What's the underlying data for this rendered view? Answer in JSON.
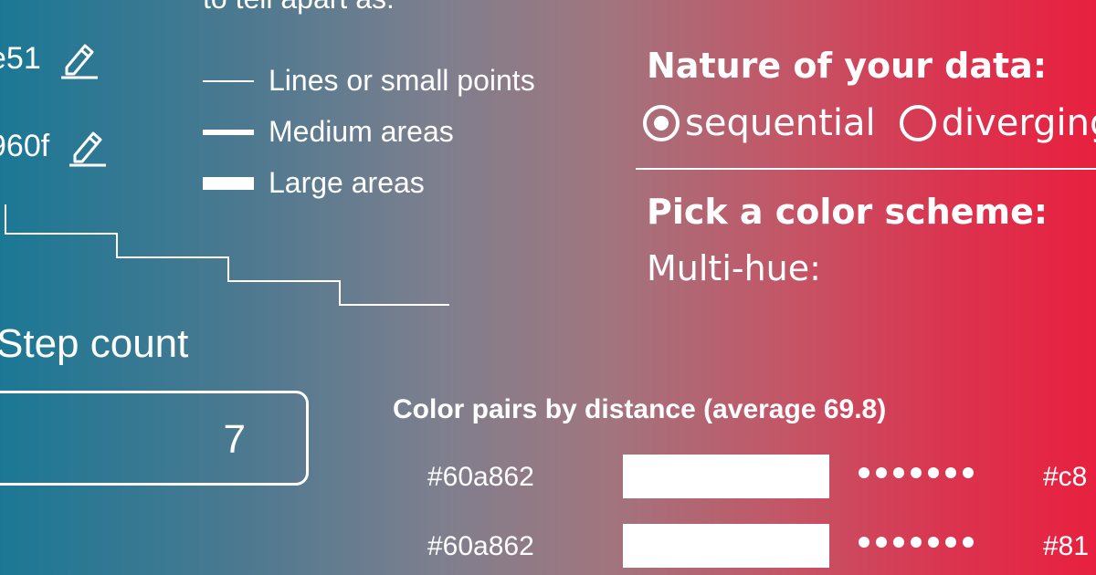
{
  "intro_text": "to tell apart as:",
  "colors": {
    "gradient_start": "#1b7895",
    "gradient_end": "#e8203f",
    "foreground": "#ffffff"
  },
  "palette_entries": [
    {
      "hex": "e51",
      "icon": "pencil-icon"
    },
    {
      "hex": "960f",
      "icon": "pencil-icon"
    }
  ],
  "usage_legend": [
    {
      "label": "Lines or small points"
    },
    {
      "label": "Medium areas"
    },
    {
      "label": "Large areas"
    }
  ],
  "step_count": {
    "label": "Step count",
    "value": "7"
  },
  "nature": {
    "heading": "Nature of your data:",
    "options": [
      {
        "label": "sequential",
        "selected": true
      },
      {
        "label": "diverging",
        "selected": false
      }
    ]
  },
  "scheme": {
    "heading": "Pick a color scheme:",
    "subheading": "Multi-hue:"
  },
  "color_pairs": {
    "title": "Color pairs by distance (average 69.8)",
    "rows": [
      {
        "left": "#60a862",
        "right": "#c8"
      },
      {
        "left": "#60a862",
        "right": "#81"
      }
    ]
  }
}
